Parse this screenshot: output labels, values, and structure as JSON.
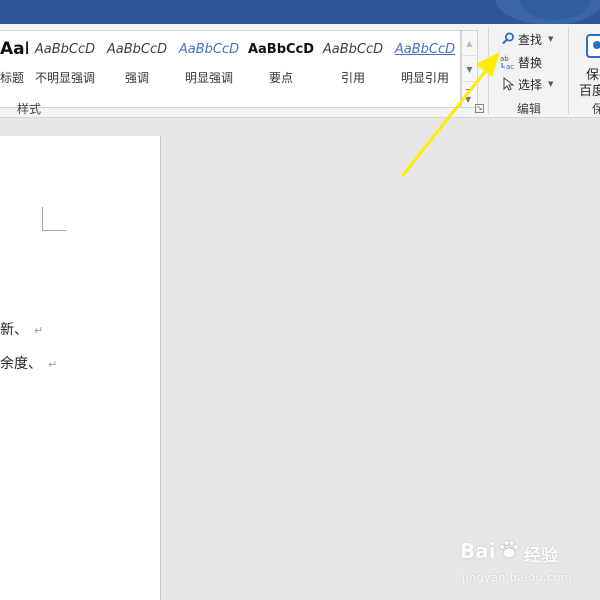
{
  "ribbon": {
    "styles_group_label": "样式",
    "styles": [
      {
        "preview": "AaBbC",
        "name": "标题"
      },
      {
        "preview": "AaBbCcD",
        "name": "不明显强调"
      },
      {
        "preview": "AaBbCcD",
        "name": "强调"
      },
      {
        "preview": "AaBbCcD",
        "name": "明显强调"
      },
      {
        "preview": "AaBbCcD",
        "name": "要点"
      },
      {
        "preview": "AaBbCcD",
        "name": "引用"
      },
      {
        "preview": "AaBbCcD",
        "name": "明显引用"
      }
    ],
    "editing": {
      "find_label": "查找",
      "replace_label": "替换",
      "select_label": "选择",
      "group_label": "编辑"
    },
    "right_group": {
      "label_line1": "保存",
      "label_line2": "百度",
      "group_label": "保"
    }
  },
  "document": {
    "lines": [
      {
        "text": "新、",
        "mark": "↵"
      },
      {
        "text": "余度、",
        "mark": "↵"
      }
    ]
  },
  "watermark": {
    "brand_left": "Bai",
    "brand_right": "经验",
    "url": "jingyan.baidu.com"
  },
  "colors": {
    "titlebar": "#2b579a",
    "accent_blue": "#4472c4",
    "annotation_arrow": "#ffec00"
  },
  "icons": {
    "find": "magnifier-icon",
    "replace": "replace-ab-icon",
    "select": "cursor-arrow-icon",
    "save": "baidu-save-icon",
    "watermark": "baidu-paw-icon"
  }
}
